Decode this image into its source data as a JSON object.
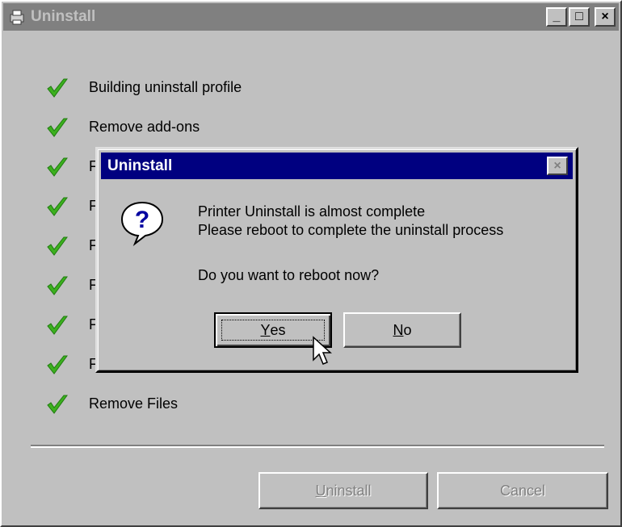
{
  "window": {
    "title": "Uninstall",
    "icon": "app-icon",
    "controls": {
      "minimize": "_",
      "maximize": "□",
      "close": "×"
    }
  },
  "steps": [
    {
      "label": "Building uninstall profile",
      "status": "done"
    },
    {
      "label": "Remove add-ons",
      "status": "done"
    },
    {
      "label": "F",
      "status": "done"
    },
    {
      "label": "F",
      "status": "done"
    },
    {
      "label": "F",
      "status": "done"
    },
    {
      "label": "F",
      "status": "done"
    },
    {
      "label": "F",
      "status": "done"
    },
    {
      "label": "F",
      "status": "done"
    },
    {
      "label": "Remove Files",
      "status": "done"
    }
  ],
  "footer": {
    "uninstall_label_underlined": "U",
    "uninstall_label_rest": "ninstall",
    "cancel_label": "Cancel"
  },
  "dialog": {
    "title": "Uninstall",
    "close": "×",
    "icon": "question-icon",
    "message_line1": "Printer Uninstall is almost complete",
    "message_line2": "Please reboot to complete the uninstall process",
    "question": "Do you want to reboot now?",
    "yes_underlined": "Y",
    "yes_rest": "es",
    "no_underlined": "N",
    "no_rest": "o"
  },
  "colors": {
    "face": "#c0c0c0",
    "active_title": "#000080",
    "inactive_title": "#808080",
    "check": "#3cb01e"
  }
}
